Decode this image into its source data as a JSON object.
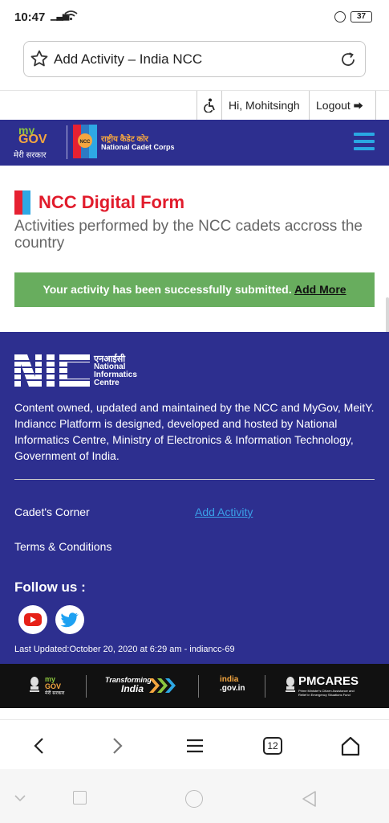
{
  "status_bar": {
    "time": "10:47",
    "battery": "37"
  },
  "browser": {
    "url_title": "Add Activity – India NCC",
    "tab_count": "12"
  },
  "utility_bar": {
    "greeting": "Hi, Mohitsingh",
    "logout_label": "Logout"
  },
  "header": {
    "mygov_my": "my",
    "mygov_gov": "GOV",
    "mygov_hi": "मेरी सरकार",
    "ncc_emblem": "NCC",
    "ncc_hindi": "राष्ट्रीय कैडेट कोर",
    "ncc_english": "National Cadet Corps"
  },
  "main": {
    "title": "NCC Digital Form",
    "subtitle": "Activities performed by the NCC cadets accross the country",
    "success_message": "Your activity has been successfully submitted.",
    "add_more_label": "Add More"
  },
  "footer": {
    "nic_hindi": "एनआईसी",
    "nic_english": "National Informatics Centre",
    "about": "Content owned, updated and maintained by the NCC and MyGov, MeitY. Indiancc Platform is designed, developed and hosted by National Informatics Centre, Ministry of Electronics & Information Technology, Government of India.",
    "links": {
      "cadets_corner": "Cadet's Corner",
      "add_activity": "Add Activity",
      "terms": "Terms & Conditions"
    },
    "follow_us": "Follow us :",
    "last_updated": "Last Updated:October 20, 2020 at 6:29 am - indiancc-69"
  },
  "partners": {
    "mygov_my": "my",
    "mygov_gov": "GOV",
    "mygov_hi": "मेरी सरकार",
    "transforming_1": "Transforming",
    "transforming_2": "India",
    "india_gov_1": "india",
    "india_gov_2": ".gov.in",
    "pmcares": "PMCARES",
    "pmcares_sub": "Prime Minister's Citizen Assistance and Relief in Emergency Situations Fund"
  },
  "colors": {
    "header_blue": "#2d2f8f",
    "title_red": "#e11c2c",
    "success_green": "#68ad5e",
    "link_blue": "#3aa0e8"
  }
}
